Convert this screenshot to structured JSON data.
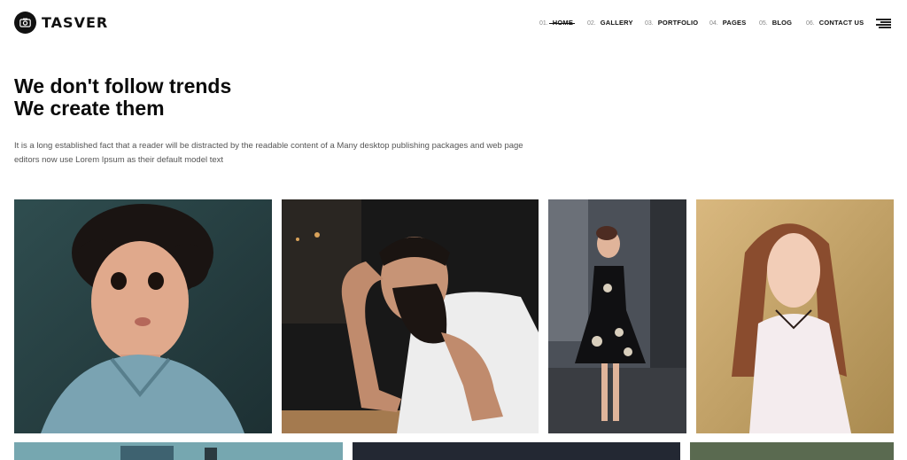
{
  "header": {
    "logo_text": "TASVER",
    "nav": [
      {
        "num": "01.",
        "label": "HOME",
        "active": true
      },
      {
        "num": "02.",
        "label": "GALLERY"
      },
      {
        "num": "03.",
        "label": "PORTFOLIO"
      },
      {
        "num": "04.",
        "label": "PAGES"
      },
      {
        "num": "05.",
        "label": "BLOG"
      },
      {
        "num": "06.",
        "label": "CONTACT US"
      }
    ]
  },
  "hero": {
    "title_line1": "We don't follow trends",
    "title_line2": "We create them",
    "description": "It is a long established fact that a reader will be distracted by the readable content of a Many desktop publishing packages and web page editors now use Lorem Ipsum as their default model text"
  },
  "gallery": {
    "photos": [
      {
        "subject": "curly-haired child in denim shirt"
      },
      {
        "subject": "bearded man with tattoos leaning on table"
      },
      {
        "subject": "woman in floral dress standing on street"
      },
      {
        "subject": "young woman with long hair in white shirt"
      }
    ]
  },
  "colors": {
    "text": "#111111",
    "muted": "#555555",
    "background": "#ffffff"
  }
}
